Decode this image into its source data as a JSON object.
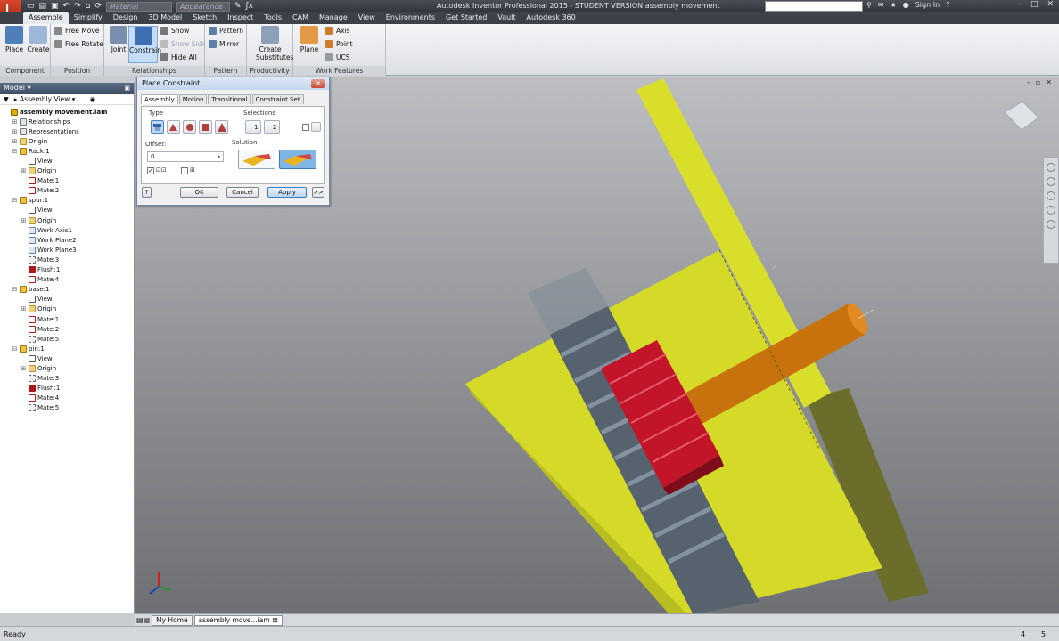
{
  "titlebar": {
    "app_letter": "I",
    "material_placeholder": "Material",
    "appearance_placeholder": "Appearance",
    "title": "Autodesk Inventor Professional 2015 - STUDENT VERSION    assembly movement",
    "sign_in": "Sign In",
    "help": "?"
  },
  "ribbon_tabs": [
    "Assemble",
    "Simplify",
    "Design",
    "3D Model",
    "Sketch",
    "Inspect",
    "Tools",
    "CAM",
    "Manage",
    "View",
    "Environments",
    "Get Started",
    "Vault",
    "Autodesk 360"
  ],
  "ribbon": {
    "component": {
      "title": "Component",
      "place": "Place",
      "create": "Create"
    },
    "position": {
      "title": "Position",
      "free_move": "Free Move",
      "free_rotate": "Free Rotate"
    },
    "relationships": {
      "title": "Relationships",
      "joint": "Joint",
      "constrain": "Constrain",
      "show": "Show",
      "show_sick": "Show Sick",
      "hide_all": "Hide All"
    },
    "pattern": {
      "title": "Pattern",
      "pattern": "Pattern",
      "mirror": "Mirror"
    },
    "productivity": {
      "title": "Productivity",
      "create_substitutes_1": "Create",
      "create_substitutes_2": "Substitutes"
    },
    "work_features": {
      "title": "Work Features",
      "plane": "Plane",
      "axis": "Axis",
      "point": "Point",
      "ucs": "UCS"
    }
  },
  "browser": {
    "header": "Model",
    "view_mode": "Assembly View",
    "nodes": [
      {
        "label": "assembly movement.iam",
        "icon": "asm",
        "depth": 0,
        "tw": ""
      },
      {
        "label": "Relationships",
        "icon": "rel",
        "depth": 1,
        "tw": "+"
      },
      {
        "label": "Representations",
        "icon": "rel",
        "depth": 1,
        "tw": "+"
      },
      {
        "label": "Origin",
        "icon": "folder",
        "depth": 1,
        "tw": "+"
      },
      {
        "label": "Rack:1",
        "icon": "part",
        "depth": 1,
        "tw": "-"
      },
      {
        "label": "View:",
        "icon": "view",
        "depth": 2,
        "tw": ""
      },
      {
        "label": "Origin",
        "icon": "folder",
        "depth": 2,
        "tw": "+"
      },
      {
        "label": "Mate:1",
        "icon": "mate",
        "depth": 2,
        "tw": ""
      },
      {
        "label": "Mate:2",
        "icon": "mate",
        "depth": 2,
        "tw": ""
      },
      {
        "label": "spur:1",
        "icon": "part",
        "depth": 1,
        "tw": "-"
      },
      {
        "label": "View:",
        "icon": "view",
        "depth": 2,
        "tw": ""
      },
      {
        "label": "Origin",
        "icon": "folder",
        "depth": 2,
        "tw": "+"
      },
      {
        "label": "Work Axis1",
        "icon": "wrk",
        "depth": 2,
        "tw": ""
      },
      {
        "label": "Work Plane2",
        "icon": "wrk",
        "depth": 2,
        "tw": ""
      },
      {
        "label": "Work Plane3",
        "icon": "wrk",
        "depth": 2,
        "tw": ""
      },
      {
        "label": "Mate:3",
        "icon": "fault",
        "depth": 2,
        "tw": ""
      },
      {
        "label": "Flush:1",
        "icon": "flush",
        "depth": 2,
        "tw": ""
      },
      {
        "label": "Mate:4",
        "icon": "mate",
        "depth": 2,
        "tw": ""
      },
      {
        "label": "base:1",
        "icon": "part",
        "depth": 1,
        "tw": "-"
      },
      {
        "label": "View:",
        "icon": "view",
        "depth": 2,
        "tw": ""
      },
      {
        "label": "Origin",
        "icon": "folder",
        "depth": 2,
        "tw": "+"
      },
      {
        "label": "Mate:1",
        "icon": "mate",
        "depth": 2,
        "tw": ""
      },
      {
        "label": "Mate:2",
        "icon": "mate",
        "depth": 2,
        "tw": ""
      },
      {
        "label": "Mate:5",
        "icon": "fault",
        "depth": 2,
        "tw": ""
      },
      {
        "label": "pin:1",
        "icon": "part",
        "depth": 1,
        "tw": "-"
      },
      {
        "label": "View:",
        "icon": "view",
        "depth": 2,
        "tw": ""
      },
      {
        "label": "Origin",
        "icon": "folder",
        "depth": 2,
        "tw": "+"
      },
      {
        "label": "Mate:3",
        "icon": "fault",
        "depth": 2,
        "tw": ""
      },
      {
        "label": "Flush:1",
        "icon": "flush",
        "depth": 2,
        "tw": ""
      },
      {
        "label": "Mate:4",
        "icon": "mate",
        "depth": 2,
        "tw": ""
      },
      {
        "label": "Mate:5",
        "icon": "fault",
        "depth": 2,
        "tw": ""
      }
    ]
  },
  "dialog": {
    "title": "Place Constraint",
    "tabs": [
      "Assembly",
      "Motion",
      "Transitional",
      "Constraint Set"
    ],
    "type_label": "Type",
    "selections_label": "Selections",
    "sel1": "1",
    "sel2": "2",
    "offset_label": "Offset:",
    "offset_value": "0",
    "solution_label": "Solution",
    "ok": "OK",
    "cancel": "Cancel",
    "apply": "Apply",
    "more": ">>"
  },
  "doc_tabs": {
    "home": "My Home",
    "file": "assembly move...iam"
  },
  "status": {
    "text": "Ready",
    "count1": "4",
    "count2": "5"
  },
  "colors": {
    "yellow": "#d9de2a",
    "gear_red": "#c2152a",
    "shaft_orange": "#c8720e",
    "rack_gray": "#59687a"
  }
}
